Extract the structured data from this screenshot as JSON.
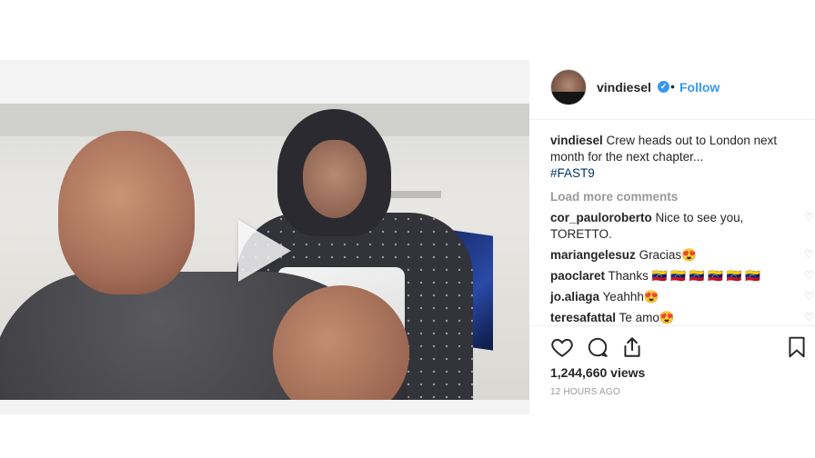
{
  "header": {
    "username": "vindiesel",
    "dot": "•",
    "follow_label": "Follow"
  },
  "caption": {
    "username": "vindiesel",
    "text": "Crew heads out to London next month for the next chapter...",
    "hashtag": "#FAST9"
  },
  "load_more_label": "Load more comments",
  "comments": [
    {
      "username": "cor_pauloroberto",
      "text": "Nice to see you, TORETTO."
    },
    {
      "username": "mariangelesuz",
      "text": "Gracias😍"
    },
    {
      "username": "paoclaret",
      "text": "Thanks 🇻🇪 🇻🇪 🇻🇪 🇻🇪 🇻🇪 🇻🇪"
    },
    {
      "username": "jo.aliaga",
      "text": "Yeahhh😍"
    },
    {
      "username": "teresafattal",
      "text": "Te amo😍"
    }
  ],
  "stats": {
    "views": "1,244,660 views",
    "time": "12 HOURS AGO"
  },
  "icons": {
    "verified": "verified-badge-icon",
    "play": "play-icon",
    "like": "heart-icon",
    "comment": "comment-icon",
    "share": "share-icon",
    "save": "bookmark-icon"
  },
  "colors": {
    "link": "#3897f0",
    "hashtag": "#003569",
    "muted": "#999999",
    "text": "#262626"
  }
}
